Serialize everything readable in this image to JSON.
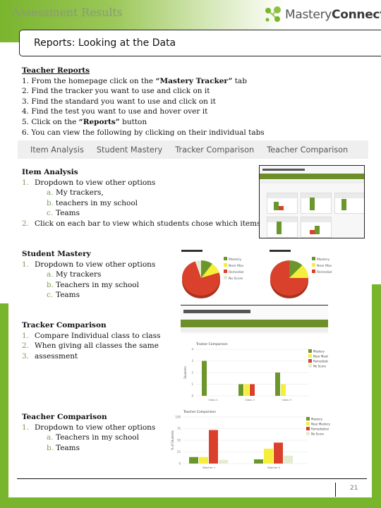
{
  "header": {
    "section_title": "Assessment Results",
    "logo": {
      "text_light": "Mastery",
      "text_bold": "Connect",
      "icon": "mastery-connect-dots-icon"
    },
    "page_title": "Reports:  Looking at the Data"
  },
  "colors": {
    "frame_green": "#79b52c",
    "list_number": "#7f9a55",
    "mastery": "#6a962c",
    "near_mastery": "#f5ee3a",
    "remediation": "#d9412c",
    "no_score": "#e3ecd0"
  },
  "teacher_reports": {
    "heading": "Teacher Reports",
    "steps": [
      {
        "n": "1.",
        "pre": "From the homepage click on the ",
        "bold": "“Mastery Tracker”",
        "post": " tab"
      },
      {
        "n": "2.",
        "pre": "Find the tracker you want to use and click on it",
        "bold": "",
        "post": ""
      },
      {
        "n": "3.",
        "pre": "Find the standard you want to use and click on it",
        "bold": "",
        "post": ""
      },
      {
        "n": "4.",
        "pre": "Find the test you want to use and hover over it",
        "bold": "",
        "post": ""
      },
      {
        "n": "5.",
        "pre": "Click on the ",
        "bold": "“Reports”",
        "post": " button"
      },
      {
        "n": "6.",
        "pre": "You can view the following by clicking on their individual tabs",
        "bold": "",
        "post": ""
      }
    ]
  },
  "tabs": [
    "Item Analysis",
    "Student Mastery",
    "Tracker Comparison",
    "Teacher Comparison"
  ],
  "item_analysis": {
    "heading": "Item Analysis",
    "items": [
      {
        "n": "1.",
        "text": "Dropdown to view other options",
        "sub": [
          {
            "n": "a.",
            "text": "My trackers,"
          },
          {
            "n": "b.",
            "text": "teachers in my school"
          },
          {
            "n": "c.",
            "text": "Teams"
          }
        ]
      },
      {
        "n": "2.",
        "text": "Click on each bar to view which students chose which items",
        "sub": []
      }
    ]
  },
  "student_mastery": {
    "heading": "Student Mastery",
    "items": [
      {
        "n": "1.",
        "text": "Dropdown to view other options",
        "sub": [
          {
            "n": "a.",
            "text": "My trackers"
          },
          {
            "n": "b.",
            "text": "Teachers in my school"
          },
          {
            "n": "c.",
            "text": "Teams"
          }
        ]
      }
    ]
  },
  "tracker_comparison": {
    "heading": "Tracker Comparison",
    "items": [
      {
        "n": "1.",
        "text": "Compare Individual class to class"
      },
      {
        "n": "2.",
        "text": "When giving all classes the same"
      },
      {
        "n": "3.",
        "text": "assessment"
      }
    ]
  },
  "teacher_comparison": {
    "heading": "Teacher Comparison",
    "items": [
      {
        "n": "1.",
        "text": "Dropdown to view other options",
        "sub": [
          {
            "n": "a.",
            "text": "Teachers in my school"
          },
          {
            "n": "b.",
            "text": "Teams"
          }
        ]
      }
    ]
  },
  "footer": {
    "page_number": "21"
  },
  "chart_data": [
    {
      "type": "pie",
      "title": "Student Mastery (left)",
      "categories": [
        "Mastery",
        "Near Mastery",
        "Remediation",
        "No Score"
      ],
      "values": [
        10,
        10,
        75,
        5
      ]
    },
    {
      "type": "pie",
      "title": "Student Mastery (right)",
      "categories": [
        "Mastery",
        "Near Mastery",
        "Remediation"
      ],
      "values": [
        12,
        13,
        75
      ]
    },
    {
      "type": "bar",
      "title": "Tracker Comparison",
      "ylabel": "Students",
      "ylim": [
        0,
        4
      ],
      "categories": [
        "Class 1",
        "Class 2",
        "Class 3"
      ],
      "series": [
        {
          "name": "Mastery",
          "values": [
            3,
            1,
            2
          ]
        },
        {
          "name": "Near Mastery",
          "values": [
            0,
            1,
            1
          ]
        },
        {
          "name": "Remediation",
          "values": [
            0,
            1,
            0
          ]
        },
        {
          "name": "No Score",
          "values": [
            0,
            0,
            0
          ]
        }
      ]
    },
    {
      "type": "bar",
      "title": "Teacher Comparison",
      "ylabel": "% of Students",
      "ylim": [
        0,
        100
      ],
      "categories": [
        "Teacher 1",
        "Teacher 2"
      ],
      "series": [
        {
          "name": "Mastery",
          "values": [
            14,
            9
          ]
        },
        {
          "name": "Near Mastery",
          "values": [
            14,
            32
          ]
        },
        {
          "name": "Remediation",
          "values": [
            72,
            45
          ]
        },
        {
          "name": "No Score",
          "values": [
            8,
            17
          ]
        }
      ]
    }
  ]
}
